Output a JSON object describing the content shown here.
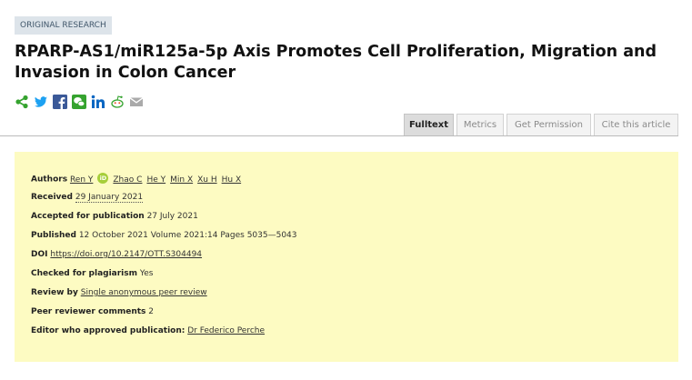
{
  "article": {
    "badge": "ORIGINAL RESEARCH",
    "title": "RPARP-AS1/miR125a-5p Axis Promotes Cell Proliferation, Migration and Invasion in Colon Cancer"
  },
  "share_icons": [
    "share-icon",
    "twitter-icon",
    "facebook-icon",
    "wechat-icon",
    "linkedin-icon",
    "reddit-icon",
    "email-icon"
  ],
  "tabs": [
    {
      "label": "Fulltext",
      "active": true
    },
    {
      "label": "Metrics",
      "active": false
    },
    {
      "label": "Get Permission",
      "active": false
    },
    {
      "label": "Cite this article",
      "active": false
    }
  ],
  "details": {
    "authors_label": "Authors",
    "authors": [
      "Ren Y",
      "Zhao C",
      "He Y",
      "Min X",
      "Xu H",
      "Hu X"
    ],
    "orcid_label": "iD",
    "received_label": "Received",
    "received": "29 January 2021",
    "accepted_label": "Accepted for publication",
    "accepted": "27 July 2021",
    "published_label": "Published",
    "published": "12 October 2021 Volume 2021:14 Pages 5035—5043",
    "doi_label": "DOI",
    "doi": "https://doi.org/10.2147/OTT.S304494",
    "plagiarism_label": "Checked for plagiarism",
    "plagiarism": "Yes",
    "review_label": "Review by",
    "review": "Single anonymous peer review",
    "comments_label": "Peer reviewer comments",
    "comments": "2",
    "editor_label": "Editor who approved publication:",
    "editor": "Dr Federico Perche"
  },
  "colors": {
    "panel": "#fdfbc2",
    "badge_bg": "#dde4ea",
    "accent_green": "#35a32f",
    "twitter": "#1da1f2",
    "facebook": "#3b5998",
    "linkedin": "#0a66c2"
  }
}
